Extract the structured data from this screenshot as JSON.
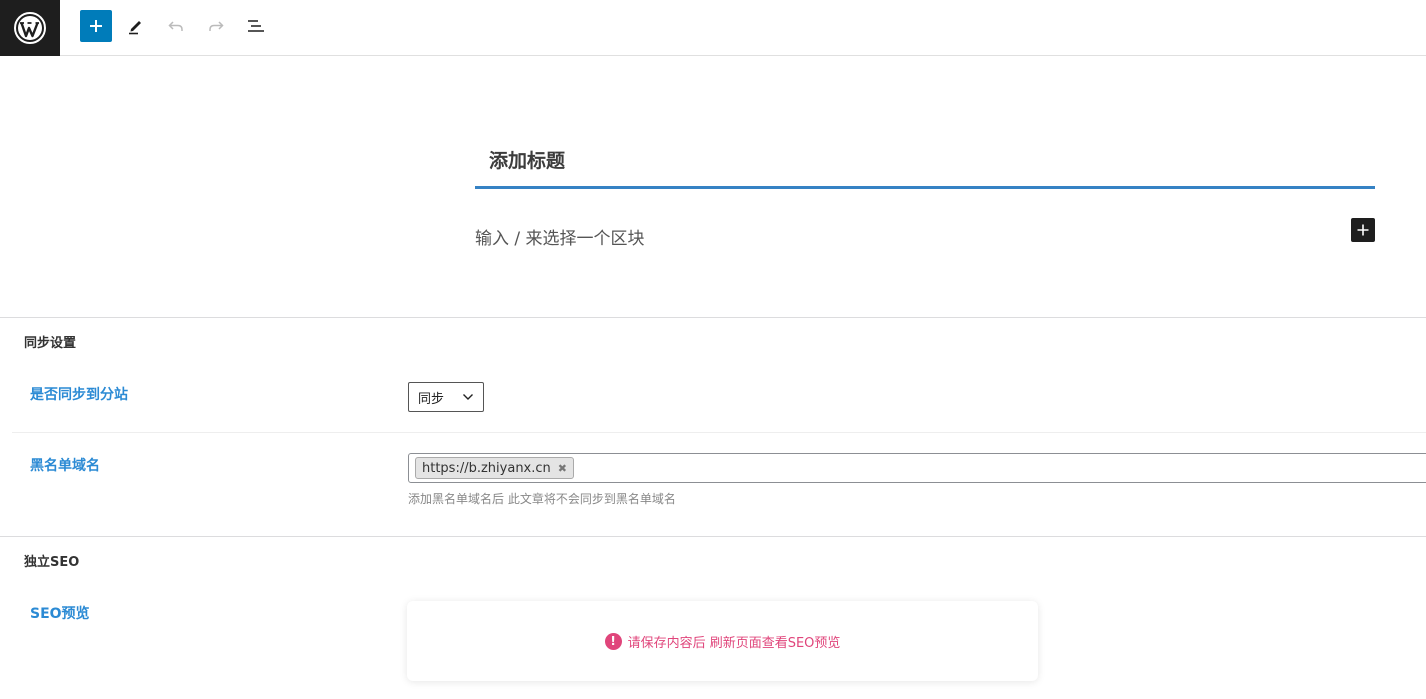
{
  "toolbar": {
    "logo_icon": "wordpress-logo",
    "add_icon": "plus-icon",
    "edit_icon": "pencil-icon",
    "undo_icon": "undo-icon",
    "redo_icon": "redo-icon",
    "list_icon": "list-view-icon",
    "accent": "#007cba"
  },
  "editor": {
    "title_placeholder": "添加标题",
    "block_placeholder": "输入 / 来选择一个区块"
  },
  "sync_settings": {
    "section_title": "同步设置",
    "sync_label": "是否同步到分站",
    "sync_value": "同步",
    "blacklist_label": "黑名单域名",
    "blacklist_tags": [
      "https://b.zhiyanx.cn"
    ],
    "tag_remove_glyph": "✖",
    "blacklist_help": "添加黑名单域名后 此文章将不会同步到黑名单域名"
  },
  "seo": {
    "section_title": "独立SEO",
    "preview_label": "SEO预览",
    "alert_glyph": "!",
    "preview_message": "请保存内容后 刷新页面查看SEO预览",
    "alert_color": "#e0457b"
  }
}
